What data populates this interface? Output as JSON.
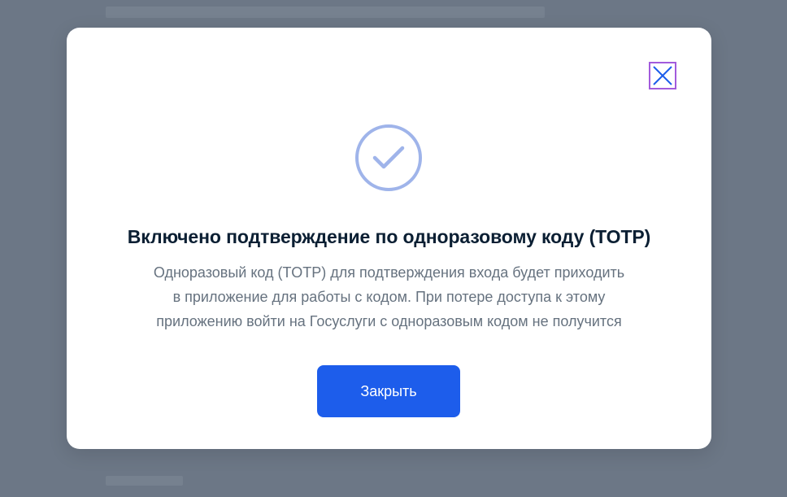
{
  "modal": {
    "title": "Включено подтверждение по одноразовому коду (TOTP)",
    "description_lines": [
      "Одноразовый код (TOTP) для подтверждения входа будет приходить",
      "в приложение для работы с кодом. При потере доступа к этому",
      "приложению войти на Госуслуги с одноразовым кодом не получится"
    ],
    "close_button_label": "Закрыть",
    "icons": {
      "status": "check-circle-icon",
      "close": "close-icon"
    }
  },
  "colors": {
    "overlay": "#6c7786",
    "primary": "#1d5deb",
    "success_icon": "#9fb4ea",
    "close_icon": "#1d5deb",
    "close_focus": "#a25bdc",
    "title": "#0b1f33",
    "text": "#66727f"
  }
}
